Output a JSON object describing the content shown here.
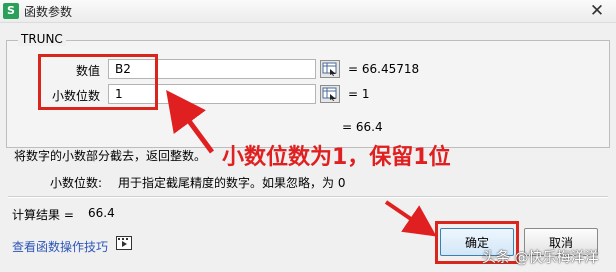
{
  "window": {
    "title": "函数参数",
    "app_icon": "S",
    "close_glyph": "✕"
  },
  "function": {
    "name": "TRUNC",
    "args": [
      {
        "label": "数值",
        "value": "B2",
        "result": "66.45718"
      },
      {
        "label": "小数位数",
        "value": "1",
        "result": "1"
      }
    ],
    "result_line": "= 66.4",
    "description": "将数字的小数部分截去，返回整数。",
    "param_label": "小数位数:",
    "param_description": "用于指定截尾精度的数字。如果忽略，为 0"
  },
  "calc": {
    "label": "计算结果 =",
    "value": "66.4"
  },
  "help": {
    "link": "查看函数操作技巧",
    "icon": "film-icon"
  },
  "buttons": {
    "ok": "确定",
    "cancel": "取消"
  },
  "annotation": "小数位数为1，保留1位",
  "watermark": "头条 @快乐梅洋洋",
  "colors": {
    "annotation_red": "#e02020",
    "link_blue": "#2d56b8"
  }
}
